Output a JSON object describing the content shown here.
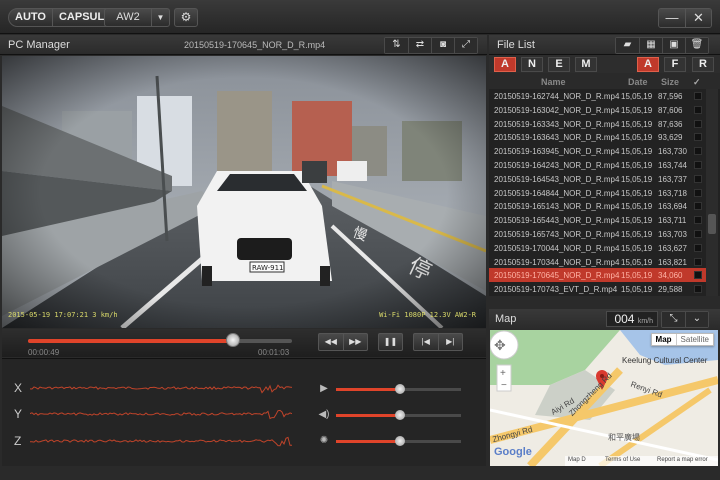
{
  "topbar": {
    "mode_auto": "AUTO",
    "mode_capsule": "CAPSULE",
    "model": "AW2",
    "settings_icon": "gear-icon",
    "minimize_label": "—",
    "close_label": "✕"
  },
  "viewer": {
    "title": "PC Manager",
    "filename": "20150519-170645_NOR_D_R.mp4",
    "overlay_left": "2015-05-19  17:07:21     3 km/h",
    "overlay_right": "Wi-Fi 1080P  12.3V  AW2-R",
    "icons": [
      "flip-vertical-icon",
      "flip-horizontal-icon",
      "camera-icon",
      "fullscreen-icon"
    ]
  },
  "playback": {
    "elapsed": "00:00:49",
    "total": "00:01:03",
    "progress": 0.777,
    "rewind_label": "◀◀",
    "forward_label": "▶▶",
    "pause_label": "❚❚",
    "prev_label": "|◀",
    "next_label": "▶|"
  },
  "sensors": {
    "axes": [
      "X",
      "Y",
      "Z"
    ],
    "sliders": [
      {
        "icon": "volume-ramp-icon",
        "glyph": "▶",
        "level": 0.51
      },
      {
        "icon": "speaker-icon",
        "glyph": "◀)",
        "level": 0.51
      },
      {
        "icon": "brightness-icon",
        "glyph": "✺",
        "level": 0.51
      }
    ]
  },
  "filelist": {
    "title": "File List",
    "tabs": [
      {
        "label": "A",
        "active": true
      },
      {
        "label": "N",
        "active": false
      },
      {
        "label": "E",
        "active": false
      },
      {
        "label": "M",
        "active": false
      },
      {
        "label": "A",
        "active": true
      },
      {
        "label": "F",
        "active": false
      },
      {
        "label": "R",
        "active": false
      }
    ],
    "columns": {
      "name": "Name",
      "date": "Date",
      "size": "Size",
      "check": "✓"
    },
    "rows": [
      {
        "name": "20150519-162744_NOR_D_R.mp4",
        "date": "15,05,19",
        "size": "87,596",
        "selected": false
      },
      {
        "name": "20150519-163042_NOR_D_R.mp4",
        "date": "15,05,19",
        "size": "87,606",
        "selected": false
      },
      {
        "name": "20150519-163343_NOR_D_R.mp4",
        "date": "15,05,19",
        "size": "87,636",
        "selected": false
      },
      {
        "name": "20150519-163643_NOR_D_R.mp4",
        "date": "15,05,19",
        "size": "93,629",
        "selected": false
      },
      {
        "name": "20150519-163945_NOR_D_R.mp4",
        "date": "15,05,19",
        "size": "163,730",
        "selected": false
      },
      {
        "name": "20150519-164243_NOR_D_R.mp4",
        "date": "15,05,19",
        "size": "163,744",
        "selected": false
      },
      {
        "name": "20150519-164543_NOR_D_R.mp4",
        "date": "15,05,19",
        "size": "163,737",
        "selected": false
      },
      {
        "name": "20150519-164844_NOR_D_R.mp4",
        "date": "15,05,19",
        "size": "163,718",
        "selected": false
      },
      {
        "name": "20150519-165143_NOR_D_R.mp4",
        "date": "15,05,19",
        "size": "163,694",
        "selected": false
      },
      {
        "name": "20150519-165443_NOR_D_R.mp4",
        "date": "15,05,19",
        "size": "163,711",
        "selected": false
      },
      {
        "name": "20150519-165743_NOR_D_R.mp4",
        "date": "15,05,19",
        "size": "163,703",
        "selected": false
      },
      {
        "name": "20150519-170044_NOR_D_R.mp4",
        "date": "15,05,19",
        "size": "163,627",
        "selected": false
      },
      {
        "name": "20150519-170344_NOR_D_R.mp4",
        "date": "15,05,19",
        "size": "163,821",
        "selected": false
      },
      {
        "name": "20150519-170645_NOR_D_R.mp4",
        "date": "15,05,19",
        "size": "34,060",
        "selected": true
      },
      {
        "name": "20150519-170743_EVT_D_R.mp4",
        "date": "15,05,19",
        "size": "29,588",
        "selected": false
      }
    ]
  },
  "map": {
    "title": "Map",
    "speed_value": "004",
    "speed_unit": "km/h",
    "type_map": "Map",
    "type_satellite": "Satellite",
    "labels": {
      "keelung": "Keelung Cultural Center",
      "renyi": "Renyi Rd",
      "aiyi": "Aiyi Rd",
      "zhongyi": "Zhongyi Rd",
      "zhongzheng": "Zhongzheng Rd",
      "heping": "和平廣場",
      "google": "Google",
      "map_data": "Map D",
      "terms": "Terms of Use",
      "report": "Report a map error"
    },
    "zoom_in": "+",
    "zoom_out": "−"
  }
}
